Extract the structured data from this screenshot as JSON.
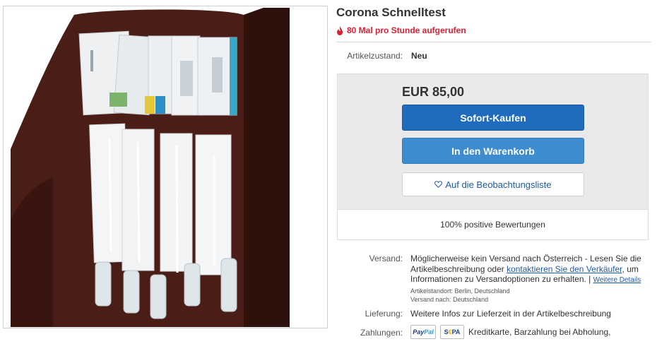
{
  "listing": {
    "title": "Corona Schnelltest",
    "views_text": "80 Mal pro Stunde aufgerufen",
    "condition_label": "Artikelzustand:",
    "condition_value": "Neu"
  },
  "buybox": {
    "price": "EUR 85,00",
    "buy_now_label": "Sofort-Kaufen",
    "cart_label": "In den Warenkorb",
    "watch_label": "Auf die Beobachtungsliste",
    "feedback": "100% positive Bewertungen"
  },
  "shipping": {
    "label": "Versand:",
    "line1": "Möglicherweise kein Versand nach Österreich - Lesen Sie die",
    "line2_pre": "Artikelbeschreibung oder ",
    "line2_link": "kontaktieren Sie den Verkäufer",
    "line2_post": ", um",
    "line3": "Informationen zu Versandoptionen zu erhalten. |",
    "details_link": "Weitere Details",
    "location": "Artikelstandort:  Berlin, Deutschland",
    "ships_to": "Versand nach:  Deutschland"
  },
  "delivery": {
    "label": "Lieferung:",
    "text": "Weitere Infos zur Lieferzeit in der Artikelbeschreibung"
  },
  "payments": {
    "label": "Zahlungen:",
    "paypal_a": "Pay",
    "paypal_b": "Pal",
    "sepa_a": "S",
    "sepa_b": "€",
    "sepa_c": "PA",
    "text": "Kreditkarte, Barzahlung bei Abholung,"
  },
  "icons": {
    "views": "flame-icon",
    "watch": "heart-icon",
    "colors": {
      "accent": "#1f6cbf",
      "cart": "#3e8cd0",
      "alert": "#dd1e31",
      "link": "#1f5aa8"
    }
  }
}
